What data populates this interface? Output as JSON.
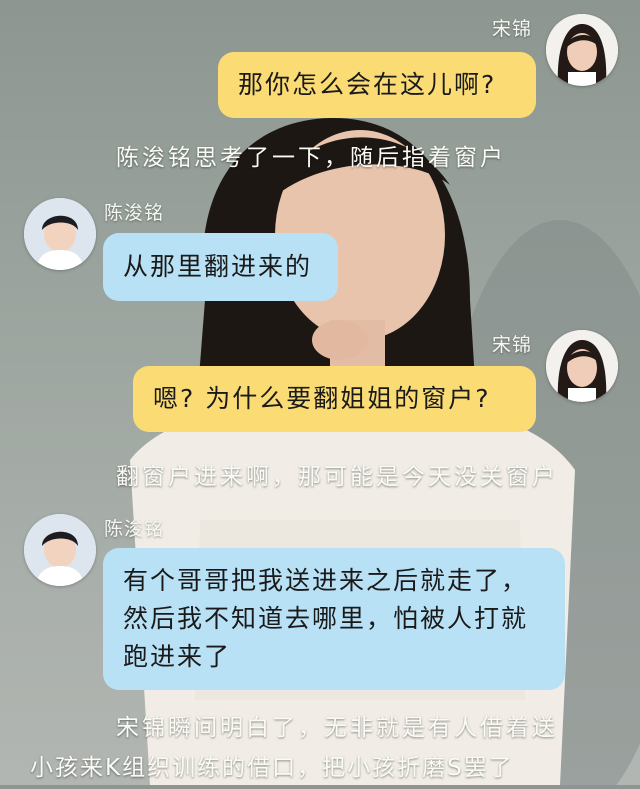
{
  "colors": {
    "right_bubble": "#fbdc74",
    "left_bubble": "#b9e1f5",
    "narration_text": "#fbfbf5"
  },
  "participants": {
    "right_name": "宋锦",
    "left_name": "陈浚铭"
  },
  "messages": [
    {
      "side": "right",
      "sender": "宋锦",
      "text": "那你怎么会在这儿啊?"
    },
    {
      "type": "narration",
      "text": "陈浚铭思考了一下，随后指着窗户"
    },
    {
      "side": "left",
      "sender": "陈浚铭",
      "text": "从那里翻进来的"
    },
    {
      "side": "right",
      "sender": "宋锦",
      "text": "嗯? 为什么要翻姐姐的窗户?"
    },
    {
      "type": "narration",
      "text": "翻窗户进来啊，那可能是今天没关窗户"
    },
    {
      "side": "left",
      "sender": "陈浚铭",
      "lines": [
        "有个哥哥把我送进来之后就走了，",
        "然后我不知道去哪里，怕被人打就",
        "跑进来了"
      ]
    },
    {
      "type": "narration",
      "lines": [
        "宋锦瞬间明白了，无非就是有人借着送",
        "小孩来K组织训练的借口，把小孩折磨S罢了"
      ]
    }
  ]
}
